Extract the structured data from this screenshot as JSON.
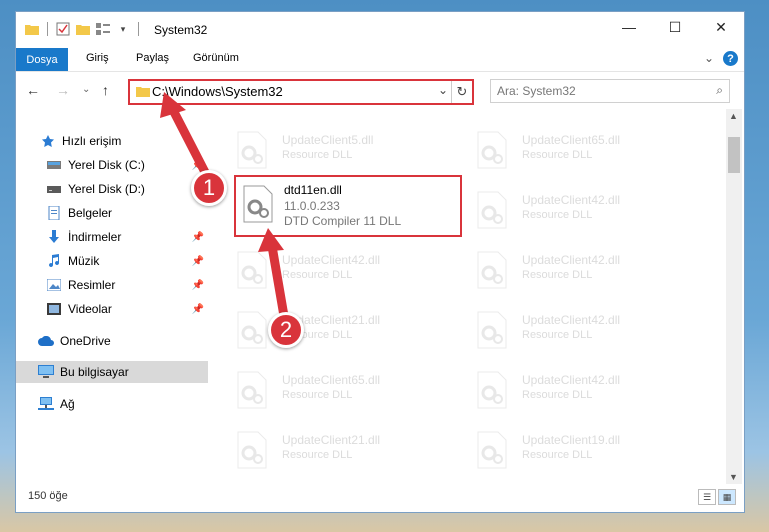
{
  "window": {
    "title": "System32",
    "minimize_glyph": "—",
    "maximize_glyph": "☐",
    "close_glyph": "✕"
  },
  "ribbon": {
    "tabs": [
      "Dosya",
      "Giriş",
      "Paylaş",
      "Görünüm"
    ],
    "collapse_glyph": "⌄",
    "help_glyph": "?"
  },
  "navbar": {
    "back_glyph": "←",
    "forward_glyph": "→",
    "dropdown_glyph": "⌄",
    "up_glyph": "↑",
    "address": "C:\\Windows\\System32",
    "address_dropdown_glyph": "⌄",
    "refresh_glyph": "↻",
    "search_placeholder": "Ara: System32",
    "search_glyph": "⌕"
  },
  "sidebar": {
    "items": [
      {
        "label": "Hızlı erişim",
        "icon": "star-icon"
      },
      {
        "label": "Yerel Disk (C:)",
        "icon": "drive-icon"
      },
      {
        "label": "Yerel Disk (D:)",
        "icon": "drive-icon"
      },
      {
        "label": "Belgeler",
        "icon": "documents-icon"
      },
      {
        "label": "İndirmeler",
        "icon": "download-icon"
      },
      {
        "label": "Müzik",
        "icon": "music-icon"
      },
      {
        "label": "Resimler",
        "icon": "pictures-icon"
      },
      {
        "label": "Videolar",
        "icon": "videos-icon"
      },
      {
        "label": "OneDrive",
        "icon": "cloud-icon"
      },
      {
        "label": "Bu bilgisayar",
        "icon": "computer-icon"
      },
      {
        "label": "Ağ",
        "icon": "network-icon"
      }
    ],
    "pin_glyph": "📌"
  },
  "files": {
    "left": [
      {
        "name": "UpdateClient5.dll",
        "desc": "Resource DLL"
      },
      {
        "name": "UpdateClient42.dll",
        "desc": "Resource DLL"
      },
      {
        "name": "UpdateClient21.dll",
        "desc": "Resource DLL"
      },
      {
        "name": "UpdateClient65.dll",
        "desc": "Resource DLL"
      },
      {
        "name": "UpdateClient21.dll",
        "desc": "Resource DLL"
      }
    ],
    "right": [
      {
        "name": "UpdateClient65.dll",
        "desc": "Resource DLL"
      },
      {
        "name": "UpdateClient42.dll",
        "desc": "Resource DLL"
      },
      {
        "name": "UpdateClient42.dll",
        "desc": "Resource DLL"
      },
      {
        "name": "UpdateClient42.dll",
        "desc": "Resource DLL"
      },
      {
        "name": "UpdateClient42.dll",
        "desc": "Resource DLL"
      },
      {
        "name": "UpdateClient19.dll",
        "desc": "Resource DLL"
      }
    ],
    "highlighted": {
      "name": "dtd11en.dll",
      "version": "11.0.0.233",
      "desc": "DTD Compiler 11 DLL"
    }
  },
  "status": {
    "count": "150 öğe"
  },
  "annotations": {
    "marker1": "1",
    "marker2": "2",
    "color": "#d9343b"
  }
}
